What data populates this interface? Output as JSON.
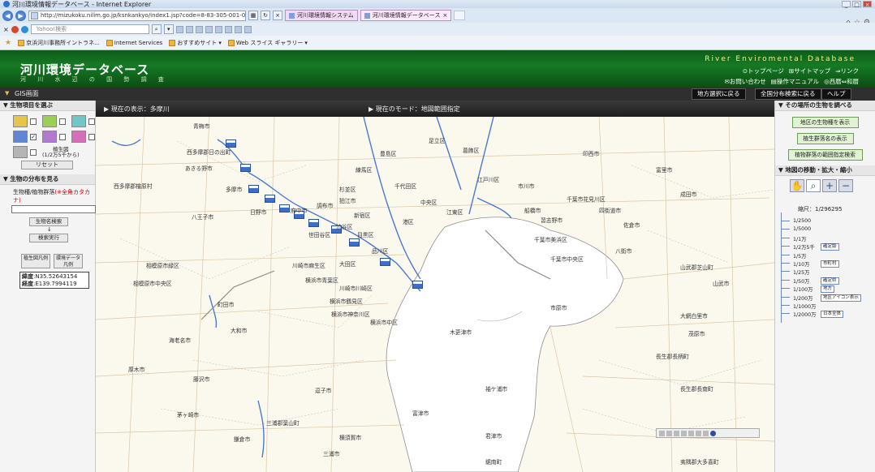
{
  "window": {
    "title": "河川環境情報データベース - Internet Explorer"
  },
  "browser": {
    "address": "http://mizukoku.nilim.go.jp/ksnkankyo/index1.jsp?code=8-83-305-001-000-4&dcode=&bs",
    "tabs": [
      "河川環境情報システム",
      "河川環境情報データベース"
    ],
    "search_placeholder": "Yahoo!検索",
    "favorites": [
      "京浜河川事務所イントラネ...",
      "Internet Services",
      "おすすめサイト",
      "Web スライス ギャラリー"
    ]
  },
  "header": {
    "title": "河川環境データベース",
    "subtitle": "河 川 水 辺 の 国 勢 調 査",
    "english": "River Enviromental Database",
    "links_row1": [
      "トップページ",
      "サイトマップ",
      "リンク"
    ],
    "links_row2": [
      "お問い合わせ",
      "操作マニュアル",
      "西暦⇔和暦"
    ]
  },
  "gisbar": {
    "title": "GIS画面",
    "buttons": [
      "地方選択に戻る",
      "全国分布検索に戻る",
      "ヘルプ"
    ]
  },
  "left": {
    "section1": "生物項目を選ぶ",
    "plants_label": "植生図",
    "plants_sub": "(1/2万5千から)",
    "reset": "リセット",
    "section2": "生物の分布を見る",
    "species_label": "生物種/植物群落",
    "species_note": "(※全角カタカナ)",
    "btn_search_name": "生物名検索",
    "btn_run": "検索実行",
    "legend_veg": "植生図凡例",
    "legend_env": "環境データ凡例",
    "lat_label": "緯度",
    "lat_value": ":N35.52643154",
    "lon_label": "経度",
    "lon_value": ":E139.7994119"
  },
  "mapbar": {
    "current": "現在の表示：多摩川",
    "mode": "現在のモード：地図範囲指定"
  },
  "right": {
    "section1": "その場所の生物を調べる",
    "btn1": "地区の生物種を表示",
    "btn2": "植生群落名の表示",
    "btn3": "植物群落の範囲指定検索",
    "section2": "地図の移動・拡大・縮小",
    "scale_label": "縮尺：1/296295",
    "scales": [
      "1/2500",
      "1/5000",
      "1/1万",
      "1/2万5千",
      "1/5万",
      "1/10万",
      "1/25万",
      "1/50万",
      "1/100万",
      "1/200万",
      "1/1000万",
      "1/2000万"
    ],
    "tags": [
      "確定版",
      "市町村",
      "確定県",
      "地方",
      "地区アイコン表示",
      "日本全体"
    ]
  },
  "map": {
    "labels": [
      "青梅市",
      "西多摩郡日の出町",
      "あきる野市",
      "西多摩郡檜原村",
      "多摩市",
      "八王子市",
      "日野市",
      "府中市",
      "調布市",
      "狛江市",
      "相模原市緑区",
      "相模原市中央区",
      "川崎市麻生区",
      "横浜市青葉区",
      "町田市",
      "大和市",
      "厚木市",
      "海老名市",
      "藤沢市",
      "茅ヶ崎市",
      "練馬区",
      "杉並区",
      "世田谷区",
      "目黒区",
      "品川区",
      "大田区",
      "川崎市川崎区",
      "横浜市鶴見区",
      "横浜市神奈川区",
      "横浜市中区",
      "足立区",
      "葛飾区",
      "江戸川区",
      "江東区",
      "中央区",
      "港区",
      "千代田区",
      "新宿区",
      "渋谷区",
      "豊島区",
      "市川市",
      "船橋市",
      "習志野市",
      "千葉市花見川区",
      "千葉市美浜区",
      "千葉市中央区",
      "市原市",
      "袖ケ浦市",
      "木更津市",
      "君津市",
      "四街道市",
      "八街市",
      "佐倉市",
      "山武郡芝山町",
      "山武市",
      "大網白里市",
      "長生郡長柄町",
      "長生郡長南町",
      "茂原市",
      "夷隅郡大多喜町",
      "横須賀市",
      "三浦市",
      "三浦郡葉山町",
      "逗子市",
      "鎌倉市",
      "富津市",
      "鋸南町",
      "富里市",
      "成田市",
      "印西市"
    ]
  }
}
